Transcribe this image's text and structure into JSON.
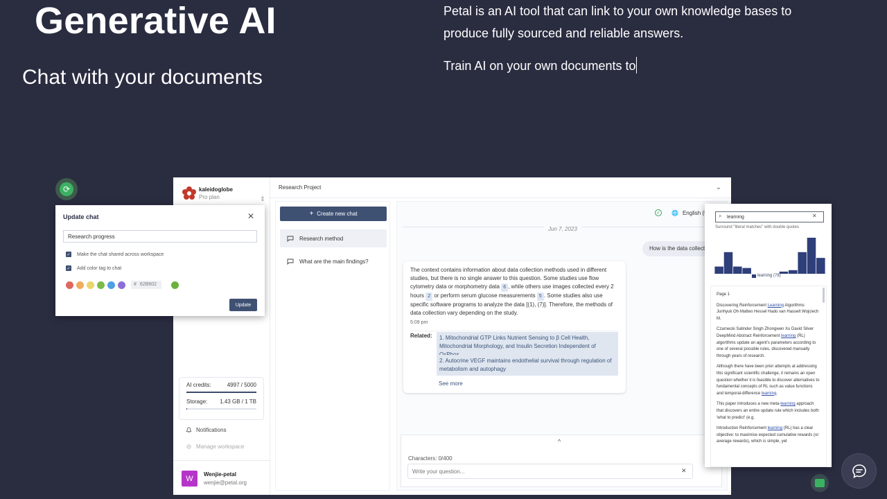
{
  "hero": {
    "title": "Generative AI",
    "subtitle": "Chat with your documents",
    "description": "Petal is an AI tool that can link to your own knowledge bases to produce fully sourced and reliable answers.",
    "typing": "Train AI on your own documents to"
  },
  "app": {
    "brand": {
      "name": "kaleidoglobe",
      "plan": "Pro plan",
      "logo_icon": "flower-logo-icon",
      "color": "#c0392b"
    },
    "project": {
      "title": "Research Project"
    },
    "usage": {
      "credits_label": "AI credits:",
      "credits_value": "4997 / 5000",
      "credits_fraction": 0.999,
      "storage_label": "Storage:",
      "storage_value": "1.43 GB / 1 TB",
      "storage_fraction": 0.0014
    },
    "side_links": {
      "notifications": "Notifications",
      "manage": "Manage workspace"
    },
    "user": {
      "initial": "W",
      "name": "Wenjie-petal",
      "email": "wenjie@petal.org"
    },
    "chatlist": {
      "create_label": "Create new chat",
      "items": [
        {
          "label": "Research method"
        },
        {
          "label": "What are the main findings?"
        }
      ]
    },
    "conversation": {
      "language": "English (U",
      "date": "Jun 7, 2023",
      "user_message": "How is the data collect",
      "answer": {
        "p1": "The context contains information about data collection methods used in different studies, but there is no single answer to this question. Some studies use flow cytometry data or morphometry data",
        "c1": "6",
        "p2": ", while others use images collected every 2 hours",
        "c2": "2",
        "p3": "or perform serum glucose measurements",
        "c3": "5",
        "p4": ". Some studies also use specific software programs to analyze the data [(1), (7)]. Therefore, the methods of data collection vary depending on the study.",
        "time": "5:09 pm"
      },
      "related_label": "Related:",
      "related": [
        "1. Mitochondrial GTP Links Nutrient Sensing to β Cell Health, Mitochondrial Morphology, and Insulin Secretion Independent of OxPhos",
        "2. Autocrine VEGF maintains endothelial survival through regulation of metabolism and autophagy"
      ],
      "see_more": "See more",
      "chars": "Characters: 0/400",
      "input_placeholder": "Write your question..."
    }
  },
  "dialog": {
    "title": "Update chat",
    "input_value": "Research progress",
    "check1": "Make the chat shared across workspace",
    "check2": "Add color tag to chat",
    "swatches": [
      "#e0675f",
      "#efac5c",
      "#ead56c",
      "#7cbb4a",
      "#4d9fe6",
      "#8b6fd6"
    ],
    "hex_symbol": "#",
    "hex_value": "62B602",
    "selected_color": "#6ab23c",
    "update_label": "Update"
  },
  "search_panel": {
    "query": "learning",
    "hint": "Surround \"literal matches\" with double quotes",
    "histogram": [
      1,
      3,
      1,
      0.8,
      0,
      0,
      0,
      0.3,
      0.5,
      3,
      5,
      2.2
    ],
    "legend": "learning (78)",
    "page_label": "Page 1",
    "results": [
      {
        "pre": "Discovering Reinforcement ",
        "hl": "Learning",
        "post": " Algorithms Junhyuk Oh·Matteo Hessel Hado van Hasselt Wojciech M."
      },
      {
        "pre": "Czarnecki Satinder Singh Zhongwen Xu David Silver DeepMind Abstract Reinforcement ",
        "hl": "learning",
        "post": " (RL) algorithms update an agent's parameters according to one of several possible rules, discovered manually through years of research."
      },
      {
        "pre": "Although there have been prior attempts at addressing this significant scientific challenge, it remains an open question whether it is feasible to discover alternatives to fundamental concepts of RL such as value functions and temporal-difference ",
        "hl": "learning",
        "post": "."
      },
      {
        "pre": "This paper introduces a new meta-",
        "hl": "learning",
        "post": " approach that discovers an entire update rule which includes both 'what to predict' (e.g."
      },
      {
        "pre": "Introduction Reinforcement ",
        "hl": "learning",
        "post": " (RL) has a clear objective: to maximise expected cumulative rewards (or average rewards), which is simple, yet"
      }
    ]
  }
}
